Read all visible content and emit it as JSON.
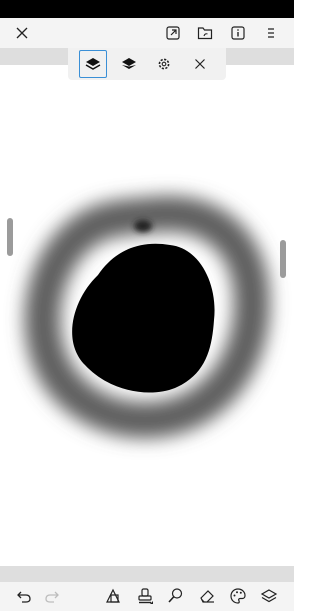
{
  "app": {
    "colors": {
      "status_bar": "#000000",
      "toolbar_bg": "#f4f4f4",
      "divider_strip": "#dedede",
      "active_outline": "#3a8fd6",
      "ink": "#000000",
      "scroll_handle": "#9b9b9b"
    }
  },
  "top_toolbar": {
    "icons": [
      "close-icon",
      "export-icon",
      "open-folder-icon",
      "info-icon",
      "menu-icon"
    ]
  },
  "layer_bar": {
    "icons": [
      "current-layer-icon",
      "layers-icon",
      "settings-icon",
      "close-icon"
    ],
    "active": "current-layer-icon"
  },
  "bottom_toolbar": {
    "icons": [
      "undo-icon",
      "redo-icon",
      "shape-tool-icon",
      "stamp-tool-icon",
      "brush-tool-icon",
      "eraser-icon",
      "color-palette-icon",
      "layers-icon"
    ],
    "disabled": [
      "redo-icon"
    ]
  }
}
